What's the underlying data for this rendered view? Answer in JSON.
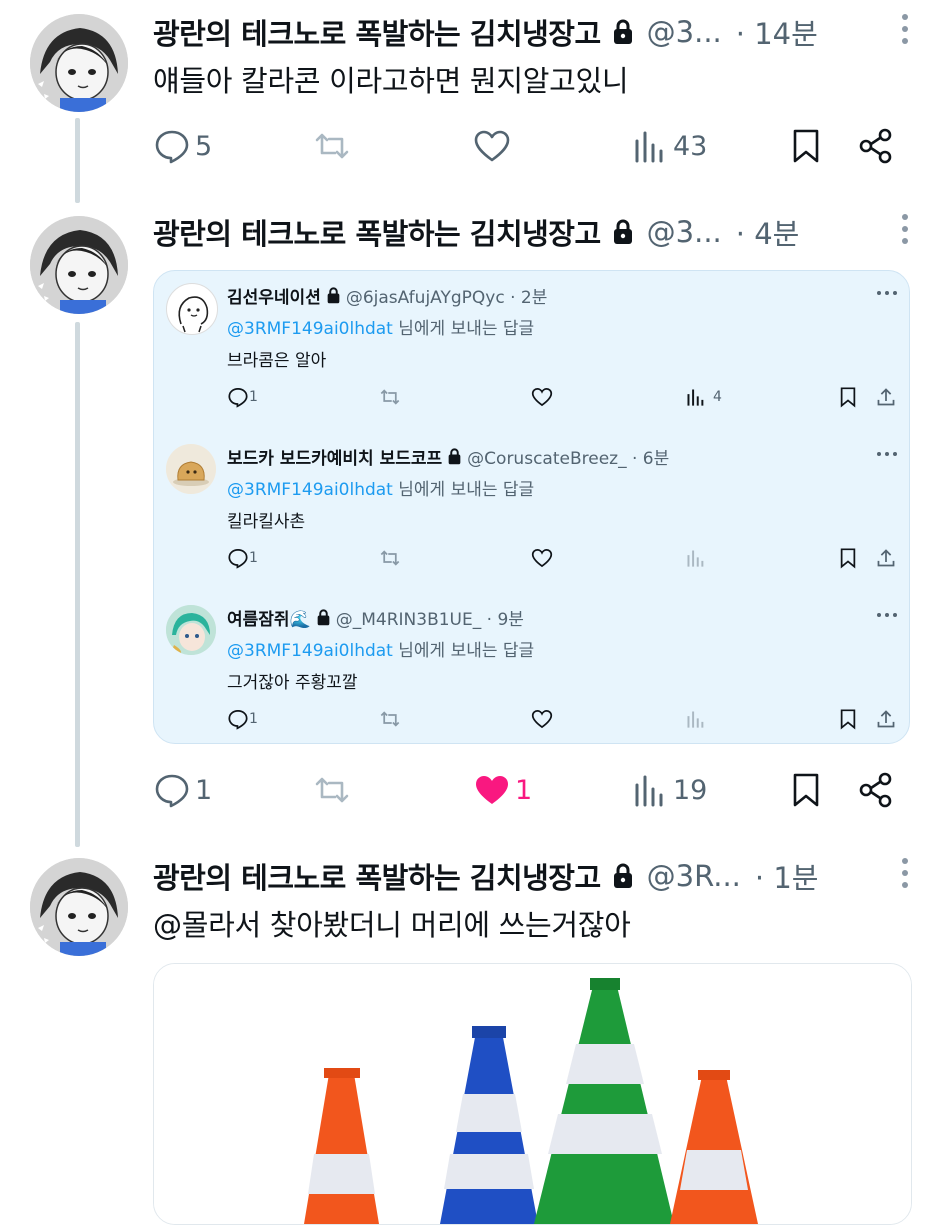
{
  "colors": {
    "accent": "#1d9bf0",
    "like": "#f91880",
    "muted": "#536471",
    "quote_bg": "#e8f5fd"
  },
  "tweets": [
    {
      "name": "광란의 테크노로 폭발하는 김치냉장고",
      "handle": "@3...",
      "time": "· 14분",
      "text": "얘들아 칼라콘 이라고하면 뭔지알고있니",
      "replies": "5",
      "retweets": "",
      "likes": "",
      "liked": false,
      "views": "43"
    },
    {
      "name": "광란의 테크노로 폭발하는 김치냉장고",
      "handle": "@3...",
      "time": "· 4분",
      "replies": "1",
      "retweets": "",
      "likes": "1",
      "liked": true,
      "views": "19"
    },
    {
      "name": "광란의 테크노로 폭발하는 김치냉장고",
      "handle": "@3R...",
      "time": "· 1분",
      "text": "@몰라서 찾아봤더니 머리에 쓰는거잖아"
    }
  ],
  "quoted_replies": [
    {
      "name": "김선우네이션",
      "handle": "@6jasAfujAYgPQyc · 2분",
      "mention": "@3RMF149ai0lhdat",
      "mention_tail": "님에게 보내는 답글",
      "text": "브라콤은 알아",
      "replies": "1",
      "views": "4",
      "avatar_icon": "cartoon-face-icon"
    },
    {
      "name": "보드카 보드카예비치 보드코프",
      "handle": "@CoruscateBreez_ · 6분",
      "mention": "@3RMF149ai0lhdat",
      "mention_tail": "님에게 보내는 답글",
      "text": "킬라킬사촌",
      "replies": "1",
      "views": "",
      "avatar_icon": "bread-icon"
    },
    {
      "name": "여름잠쥐🌊",
      "handle": "@_M4RIN3B1UE_ · 9분",
      "mention": "@3RMF149ai0lhdat",
      "mention_tail": "님에게 보내는 답글",
      "text": "그거잖아 주황꼬깔",
      "replies": "1",
      "views": "",
      "avatar_icon": "anime-avatar-icon"
    }
  ],
  "media": {
    "image_subject": "traffic-cones-image",
    "cone_colors": [
      "#f2561d",
      "#1f4fc4",
      "#1e9b3a",
      "#f2561d"
    ]
  }
}
